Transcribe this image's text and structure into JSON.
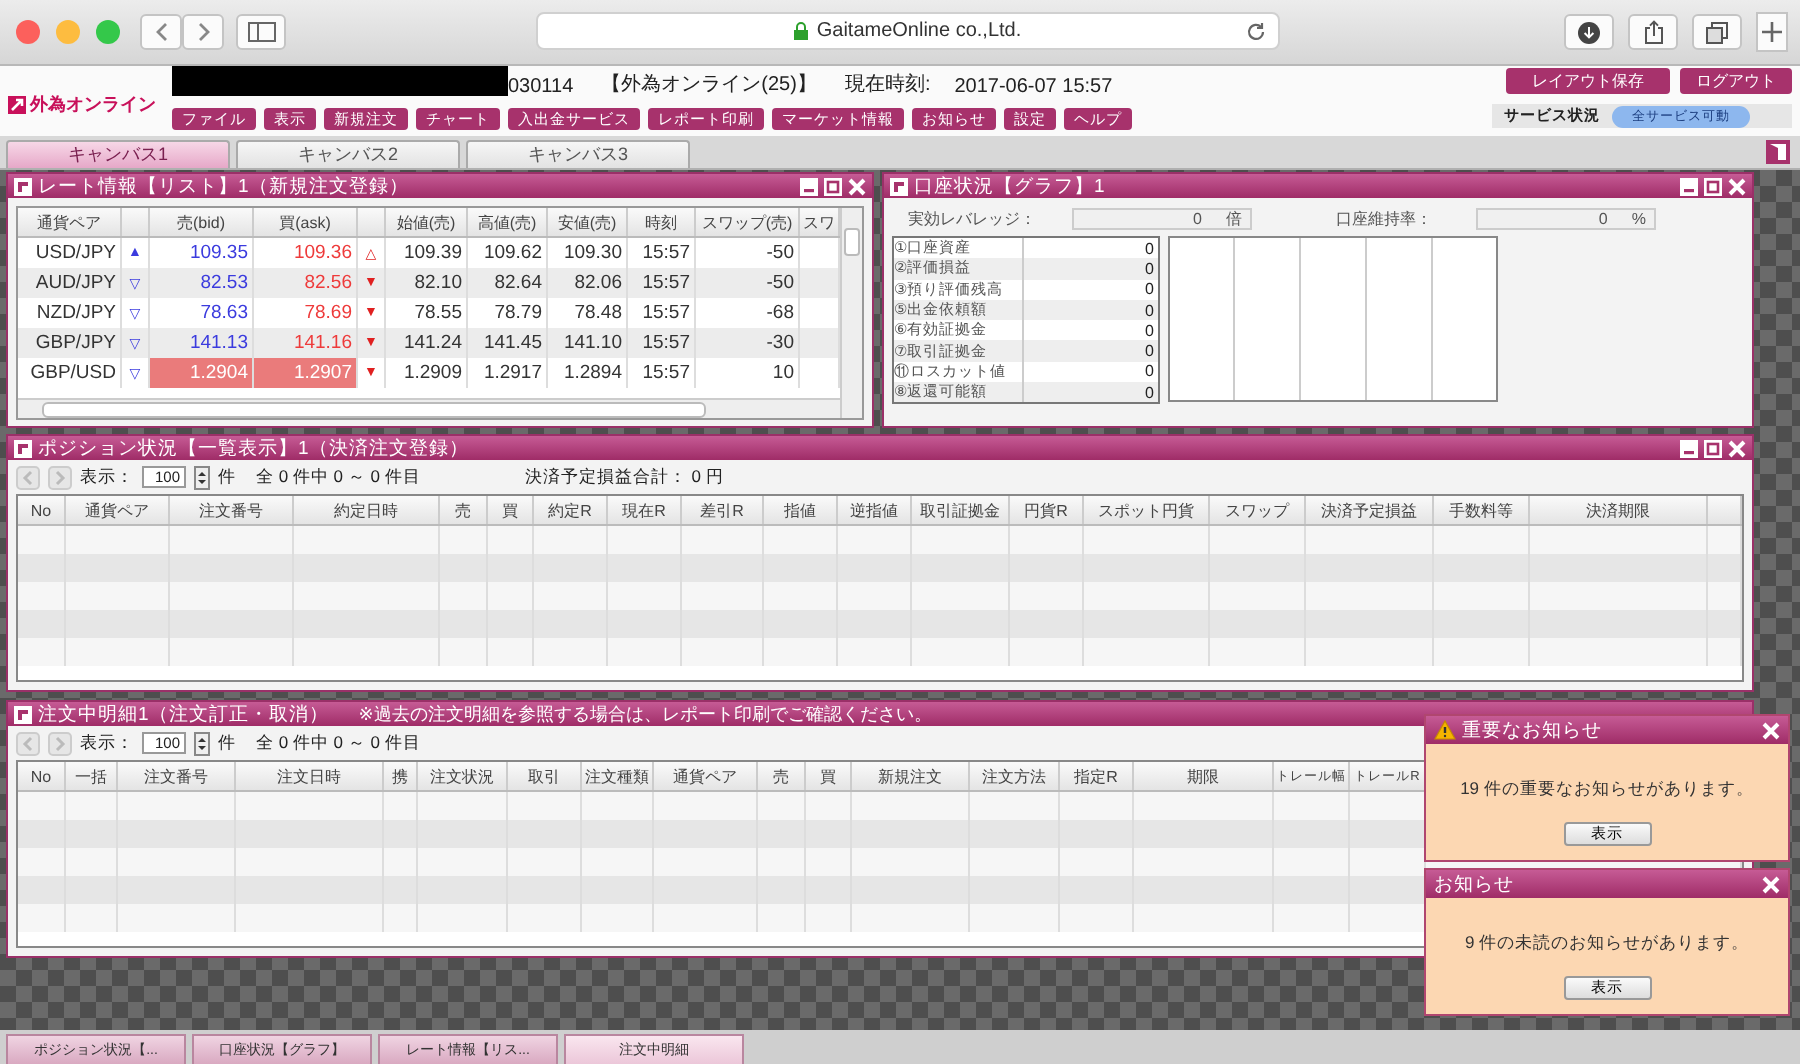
{
  "browser": {
    "url": "GaitameOnline co.,Ltd."
  },
  "header": {
    "logo": "外為オンライン",
    "account_id": "030114",
    "account_name": "【外為オンライン(25)】",
    "time_label": "現在時刻:",
    "time": "2017-06-07 15:57",
    "menu": [
      "ファイル",
      "表示",
      "新規注文",
      "チャート",
      "入出金サービス",
      "レポート印刷",
      "マーケット情報",
      "お知らせ",
      "設定",
      "ヘルプ"
    ],
    "actions": [
      "レイアウト保存",
      "ログアウト"
    ],
    "service_label": "サービス状況",
    "service_status": "全サービス可動"
  },
  "canvas_tabs": [
    {
      "label": "キャンバス1",
      "selected": true
    },
    {
      "label": "キャンバス2",
      "selected": false
    },
    {
      "label": "キャンバス3",
      "selected": false
    }
  ],
  "rate_panel": {
    "title": "レート情報【リスト】1（新規注文登録）",
    "columns": [
      "通貨ペア",
      "売(bid)",
      "買(ask)",
      "始値(売)",
      "高値(売)",
      "安値(売)",
      "時刻",
      "スワップ(売)",
      "スワ"
    ],
    "rows": [
      {
        "pair": "USD/JPY",
        "bid_arrow": "▲",
        "bid": "109.35",
        "ask": "109.36",
        "ask_arrow": "△",
        "open": "109.39",
        "high": "109.62",
        "low": "109.30",
        "time": "15:57",
        "swap": "-50",
        "highlighted": false
      },
      {
        "pair": "AUD/JPY",
        "bid_arrow": "▽",
        "bid": "82.53",
        "ask": "82.56",
        "ask_arrow": "▼",
        "open": "82.10",
        "high": "82.64",
        "low": "82.06",
        "time": "15:57",
        "swap": "-50",
        "highlighted": false
      },
      {
        "pair": "NZD/JPY",
        "bid_arrow": "▽",
        "bid": "78.63",
        "ask": "78.69",
        "ask_arrow": "▼",
        "open": "78.55",
        "high": "78.79",
        "low": "78.48",
        "time": "15:57",
        "swap": "-68",
        "highlighted": false
      },
      {
        "pair": "GBP/JPY",
        "bid_arrow": "▽",
        "bid": "141.13",
        "ask": "141.16",
        "ask_arrow": "▼",
        "open": "141.24",
        "high": "141.45",
        "low": "141.10",
        "time": "15:57",
        "swap": "-30",
        "highlighted": false
      },
      {
        "pair": "GBP/USD",
        "bid_arrow": "▽",
        "bid": "1.2904",
        "ask": "1.2907",
        "ask_arrow": "▼",
        "open": "1.2909",
        "high": "1.2917",
        "low": "1.2894",
        "time": "15:57",
        "swap": "10",
        "highlighted": true
      }
    ]
  },
  "account_panel": {
    "title": "口座状況【グラフ】1",
    "leverage": {
      "label": "実効レバレッジ：",
      "value": "0",
      "unit": "倍"
    },
    "margin_ratio": {
      "label": "口座維持率：",
      "value": "0",
      "unit": "%"
    },
    "items": [
      {
        "label": "①口座資産",
        "value": "0"
      },
      {
        "label": "②評価損益",
        "value": "0"
      },
      {
        "label": "③預り評価残高",
        "value": "0"
      },
      {
        "label": "⑤出金依頼額",
        "value": "0"
      },
      {
        "label": "⑥有効証拠金",
        "value": "0"
      },
      {
        "label": "⑦取引証拠金",
        "value": "0"
      },
      {
        "label": "⑪ロスカット値",
        "value": "0"
      },
      {
        "label": "⑧返還可能額",
        "value": "0"
      }
    ]
  },
  "position_panel": {
    "title": "ポジション状況【一覧表示】1（決済注文登録）",
    "toolbar": {
      "nav_disabled": true,
      "show_label": "表示：",
      "page_size": "100",
      "unit": "件",
      "range": "全 0 件中 0 ～ 0 件目",
      "total": "決済予定損益合計： 0 円"
    },
    "columns": [
      "No",
      "通貨ペア",
      "注文番号",
      "約定日時",
      "売",
      "買",
      "約定R",
      "現在R",
      "差引R",
      "指値",
      "逆指値",
      "取引証拠金",
      "円貨R",
      "スポット円貨",
      "スワップ",
      "決済予定損益",
      "手数料等",
      "決済期限"
    ]
  },
  "order_panel": {
    "title": "注文中明細1（注文訂正・取消）",
    "note": "※過去の注文明細を参照する場合は、レポート印刷でご確認ください。",
    "toolbar": {
      "nav_disabled": true,
      "show_label": "表示：",
      "page_size": "100",
      "unit": "件",
      "range": "全 0 件中 0 ～ 0 件目"
    },
    "columns": [
      "No",
      "一括",
      "注文番号",
      "注文日時",
      "携",
      "注文状況",
      "取引",
      "注文種類",
      "通貨ペア",
      "売",
      "買",
      "新規注文",
      "注文方法",
      "指定R",
      "期限",
      "トレール幅",
      "トレールR"
    ]
  },
  "notices": [
    {
      "kind": "important",
      "title": "重要なお知らせ",
      "message": "19 件の重要なお知らせがあります。",
      "button": "表示"
    },
    {
      "kind": "normal",
      "title": "お知らせ",
      "message": "9 件の未読のお知らせがあります。",
      "button": "表示"
    }
  ],
  "taskbar": [
    {
      "label": "ポジション状況【...",
      "selected": false
    },
    {
      "label": "口座状況【グラフ】",
      "selected": false
    },
    {
      "label": "レート情報【リス...",
      "selected": false
    },
    {
      "label": "注文中明細",
      "selected": true
    }
  ]
}
